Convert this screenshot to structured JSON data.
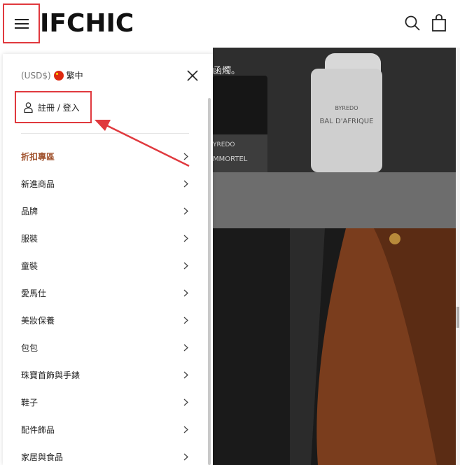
{
  "header": {
    "logo_text": "IFCHIC",
    "menu_icon": "hamburger-icon",
    "search_icon": "search-icon",
    "bag_icon": "shopping-bag-icon"
  },
  "background": {
    "hero_text": "函燭。",
    "bottle_left_label_1": "YREDO",
    "bottle_left_label_2": "MMORTEL",
    "bottle_right_label_1": "BYREDO",
    "bottle_right_label_2": "BAL D'AFRIQUE"
  },
  "drawer": {
    "currency": "(USD$)",
    "language": "繁中",
    "close_icon": "close-icon",
    "login_label": "註冊 / 登入",
    "user_icon": "user-icon",
    "menu_items": [
      {
        "label": "折扣專區",
        "highlight": true
      },
      {
        "label": "新進商品"
      },
      {
        "label": "品牌"
      },
      {
        "label": "服裝"
      },
      {
        "label": "童裝"
      },
      {
        "label": "愛馬仕"
      },
      {
        "label": "美妝保養"
      },
      {
        "label": "包包"
      },
      {
        "label": "珠寶首飾與手錶"
      },
      {
        "label": "鞋子"
      },
      {
        "label": "配件飾品"
      },
      {
        "label": "家居與食品"
      }
    ]
  },
  "colors": {
    "highlight_box": "#e0393e",
    "sale_text": "#a0522d"
  }
}
